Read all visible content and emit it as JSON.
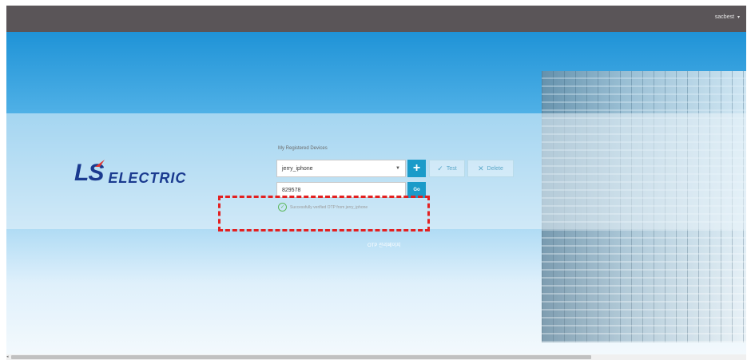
{
  "header": {
    "user_label": "sacbest",
    "caret": "▾"
  },
  "brand": {
    "logo_ls": "LS",
    "logo_electric": "ELECTRIC"
  },
  "devices": {
    "section_label": "My Registered Devices",
    "selected_device": "jerry_iphone",
    "add_label": "+",
    "test_label": "Test",
    "delete_label": "Delete"
  },
  "verify": {
    "code_value": "829578",
    "go_label": "Go",
    "success_message": "Successfully verified OTP from jerry_iphone"
  },
  "otp_link": "OTP 관리페이지",
  "colors": {
    "accent": "#1b9bc9",
    "highlight": "#e32020",
    "topbar": "#5a5558",
    "brand": "#1a3a8f"
  }
}
